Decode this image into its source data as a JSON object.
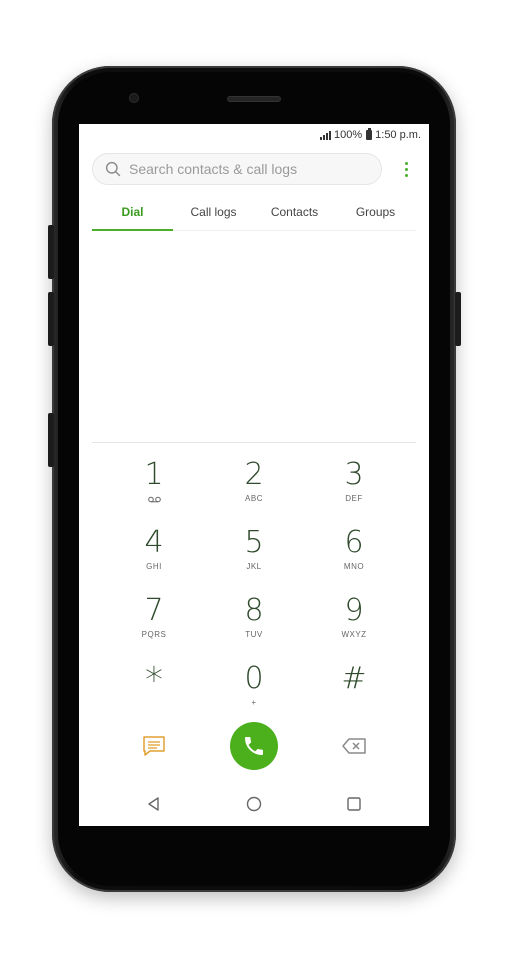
{
  "status_bar": {
    "battery": "100%",
    "time": "1:50 p.m."
  },
  "search": {
    "placeholder": "Search contacts & call logs",
    "value": ""
  },
  "tabs": [
    {
      "label": "Dial",
      "active": true
    },
    {
      "label": "Call logs",
      "active": false
    },
    {
      "label": "Contacts",
      "active": false
    },
    {
      "label": "Groups",
      "active": false
    }
  ],
  "dialed_number": "",
  "keypad": [
    {
      "digit": "1",
      "sub": "",
      "sub_icon": "voicemail-icon"
    },
    {
      "digit": "2",
      "sub": "ABC"
    },
    {
      "digit": "3",
      "sub": "DEF"
    },
    {
      "digit": "4",
      "sub": "GHI"
    },
    {
      "digit": "5",
      "sub": "JKL"
    },
    {
      "digit": "6",
      "sub": "MNO"
    },
    {
      "digit": "7",
      "sub": "PQRS"
    },
    {
      "digit": "8",
      "sub": "TUV"
    },
    {
      "digit": "9",
      "sub": "WXYZ"
    },
    {
      "digit": "*",
      "sub": ""
    },
    {
      "digit": "0",
      "sub": "+"
    },
    {
      "digit": "#",
      "sub": ""
    }
  ],
  "actions": {
    "message_icon": "message-icon",
    "call_icon": "phone-icon",
    "backspace_icon": "backspace-icon"
  },
  "nav": {
    "back_icon": "back-triangle-icon",
    "home_icon": "home-circle-icon",
    "recents_icon": "recents-square-icon"
  },
  "colors": {
    "accent": "#4caf2a",
    "call_button": "#4caf1c",
    "digit": "#2f4a2c",
    "message_icon": "#e0a030",
    "nav_icon": "#666666"
  }
}
